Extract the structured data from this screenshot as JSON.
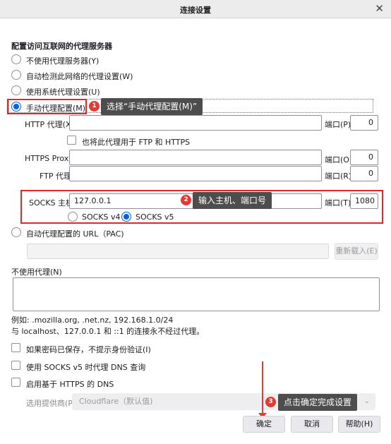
{
  "window": {
    "title": "连接设置",
    "close_glyph": "✕"
  },
  "section": {
    "heading": "配置访问互联网的代理服务器"
  },
  "proxy_modes": [
    {
      "label": "不使用代理服务器(Y)",
      "checked": false
    },
    {
      "label": "自动检测此网络的代理设置(W)",
      "checked": false
    },
    {
      "label": "使用系统代理设置(U)",
      "checked": false
    },
    {
      "label": "手动代理配置(M)",
      "checked": true
    }
  ],
  "http": {
    "label": "HTTP 代理(X)",
    "host": "",
    "port_label": "端口(P)",
    "port": "0"
  },
  "also_use": {
    "label": "也将此代理用于 FTP 和 HTTPS"
  },
  "https": {
    "label": "HTTPS Proxy",
    "host": "",
    "port_label": "端口(O)",
    "port": "0"
  },
  "ftp": {
    "label": "FTP 代理",
    "host": "",
    "port_label": "端口(R)",
    "port": "0"
  },
  "socks": {
    "label": "SOCKS 主机",
    "host": "127.0.0.1",
    "port_label": "端口(T)",
    "port": "1080",
    "v4_label": "SOCKS v4",
    "v5_label": "SOCKS v5"
  },
  "pac": {
    "label": "自动代理配置的 URL（PAC)",
    "url": "",
    "reload_label": "重新载入(E)"
  },
  "no_proxy": {
    "label": "不使用代理(N)",
    "value": "",
    "example": "例如: .mozilla.org, .net.nz, 192.168.1.0/24",
    "note": "与 localhost、127.0.0.1 和 ::1 的连接永不经过代理。"
  },
  "options": [
    {
      "label": "如果密码已保存，不提示身份验证(I)",
      "checked": false
    },
    {
      "label": "使用 SOCKS v5 时代理 DNS 查询",
      "checked": false
    },
    {
      "label": "启用基于 HTTPS 的 DNS",
      "checked": false
    }
  ],
  "dns_provider": {
    "label": "选用提供商(P)",
    "value": "Cloudflare（默认值)",
    "chevron": "⌄"
  },
  "buttons": {
    "ok": "确定",
    "cancel": "取消",
    "help": "帮助(H)"
  },
  "annotations": [
    {
      "number": "1",
      "text": "选择“手动代理配置(M)”"
    },
    {
      "number": "2",
      "text": "输入主机、端口号"
    },
    {
      "number": "3",
      "text": "点击确定完成设置"
    }
  ],
  "colors": {
    "accent": "#0061e0",
    "annotation_red": "#e53935",
    "tooltip_bg": "#4d4d4d"
  }
}
